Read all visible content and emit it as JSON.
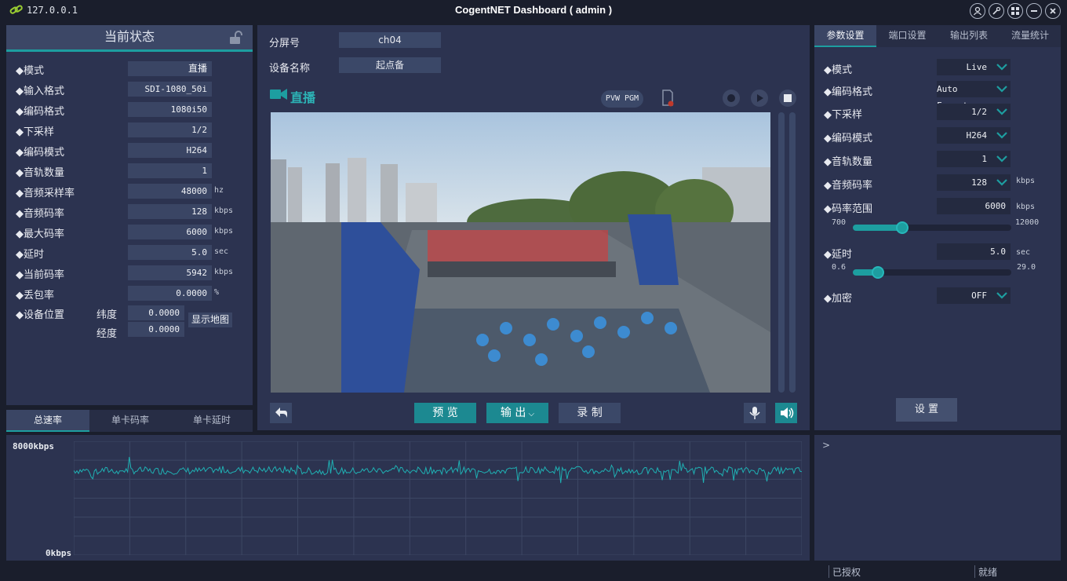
{
  "titlebar": {
    "ip": "127.0.0.1",
    "title": "CogentNET Dashboard ( admin )",
    "icons": [
      "link-icon",
      "user-icon",
      "wrench-icon",
      "grid-icon",
      "minimize-icon",
      "close-icon"
    ]
  },
  "status": {
    "title": "当前状态",
    "rows": [
      {
        "label": "◆模式",
        "value": "直播",
        "unit": ""
      },
      {
        "label": "◆输入格式",
        "value": "SDI-1080_50i",
        "unit": ""
      },
      {
        "label": "◆编码格式",
        "value": "1080i50",
        "unit": ""
      },
      {
        "label": "◆下采样",
        "value": "1/2",
        "unit": ""
      },
      {
        "label": "◆编码模式",
        "value": "H264",
        "unit": ""
      },
      {
        "label": "◆音轨数量",
        "value": "1",
        "unit": ""
      },
      {
        "label": "◆音频采样率",
        "value": "48000",
        "unit": "hz"
      },
      {
        "label": "◆音频码率",
        "value": "128",
        "unit": "kbps"
      },
      {
        "label": "◆最大码率",
        "value": "6000",
        "unit": "kbps"
      },
      {
        "label": "◆延时",
        "value": "5.0",
        "unit": "sec"
      },
      {
        "label": "◆当前码率",
        "value": "5942",
        "unit": "kbps"
      },
      {
        "label": "◆丢包率",
        "value": "0.0000",
        "unit": "%"
      }
    ],
    "location": {
      "label": "◆设备位置",
      "lat_label": "纬度",
      "lat": "0.0000",
      "lon_label": "经度",
      "lon": "0.0000",
      "map_button": "显示地图"
    }
  },
  "bottom_tabs": [
    "总速率",
    "单卡码率",
    "单卡延时"
  ],
  "center": {
    "screen_label": "分屏号",
    "screen_value": "ch04",
    "device_label": "设备名称",
    "device_value": "起点备",
    "live_label": "直播",
    "pvw": "PVW",
    "pgm": "PGM",
    "buttons": {
      "preview": "预 览",
      "output": "输 出",
      "record": "录 制"
    }
  },
  "right": {
    "tabs": [
      "参数设置",
      "端口设置",
      "输出列表",
      "流量统计"
    ],
    "settings": [
      {
        "label": "◆模式",
        "value": "Live",
        "type": "select"
      },
      {
        "label": "◆编码格式",
        "value": "Auto Format",
        "type": "select"
      },
      {
        "label": "◆下采样",
        "value": "1/2",
        "type": "select"
      },
      {
        "label": "◆编码模式",
        "value": "H264",
        "type": "select"
      },
      {
        "label": "◆音轨数量",
        "value": "1",
        "type": "select"
      },
      {
        "label": "◆音频码率",
        "value": "128",
        "type": "select",
        "unit": "kbps"
      }
    ],
    "bitrate": {
      "label": "◆码率范围",
      "value": "6000",
      "unit": "kbps",
      "min": "700",
      "max": "12000",
      "fraction": 0.31
    },
    "delay": {
      "label": "◆延时",
      "value": "5.0",
      "unit": "sec",
      "min": "0.6",
      "max": "29.0",
      "fraction": 0.16
    },
    "encrypt": {
      "label": "◆加密",
      "value": "OFF"
    },
    "apply_button": "设 置"
  },
  "chart": {
    "ymax_label": "8000kbps",
    "ymin_label": "0kbps"
  },
  "chart_data": {
    "type": "line",
    "title": "",
    "ylim": [
      0,
      8000
    ],
    "ylabel": "",
    "series": [
      {
        "values": [
          5950,
          5920,
          5980,
          5900,
          5960,
          5940,
          5990,
          5910,
          5950,
          5930
        ]
      }
    ],
    "grid": true
  },
  "log": {
    "prompt": ">"
  },
  "statusbar": {
    "license": "已授权",
    "state": "就绪"
  },
  "colors": {
    "accent": "#1d9ea0",
    "panel": "#2c3350",
    "background": "#1a1e2c"
  }
}
